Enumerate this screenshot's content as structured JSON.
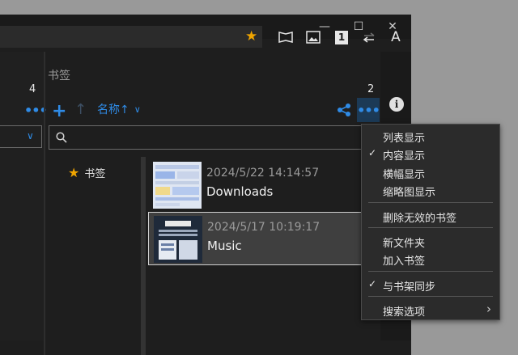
{
  "window": {
    "close_glyph": "✕",
    "maximize_glyph": "☐",
    "minimize_glyph": "—"
  },
  "toolbar": {
    "favorite_icon": "star-icon",
    "page_number": "1",
    "text_icon_glyph": "A"
  },
  "left_panel": {
    "count": "4",
    "more_glyph": "•••",
    "combo_chevron": "∨"
  },
  "bookmarks_panel": {
    "title": "书签",
    "count": "2",
    "add_glyph": "+",
    "up_glyph": "↑",
    "sort_label": "名称↑",
    "sort_chevron": "∨",
    "more_glyph": "•••",
    "search": {
      "value": "",
      "placeholder": ""
    },
    "tree": [
      {
        "label": "书签"
      }
    ],
    "entries": [
      {
        "date": "2024/5/22 14:14:57",
        "name": "Downloads",
        "selected": false
      },
      {
        "date": "2024/5/17 10:19:17",
        "name": "Music",
        "selected": true
      }
    ],
    "info_glyph": "i"
  },
  "context_menu": {
    "items": [
      {
        "label": "列表显示",
        "checked": false
      },
      {
        "label": "内容显示",
        "checked": true
      },
      {
        "label": "横幅显示",
        "checked": false
      },
      {
        "label": "缩略图显示",
        "checked": false
      },
      {
        "label": "删除无效的书签",
        "checked": false
      },
      {
        "label": "新文件夹",
        "checked": false
      },
      {
        "label": "加入书签",
        "checked": false
      },
      {
        "label": "与书架同步",
        "checked": true
      },
      {
        "label": "搜索选项",
        "checked": false,
        "submenu": true
      }
    ],
    "check_glyph": "✓",
    "submenu_glyph": "›"
  },
  "colors": {
    "accent": "#2f8be6",
    "star": "#f0a500",
    "background": "#1e1e1e"
  }
}
